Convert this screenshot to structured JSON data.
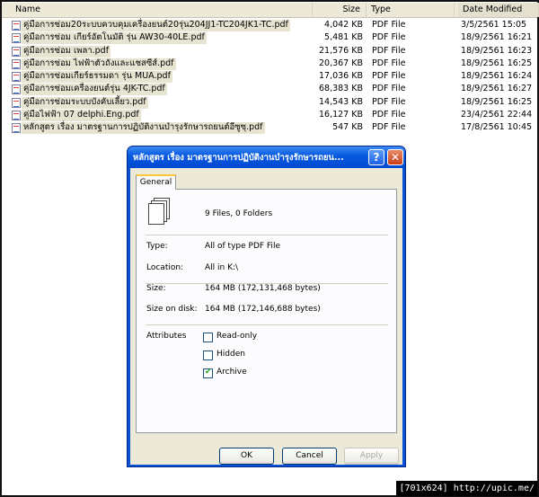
{
  "columns": {
    "name": "Name",
    "size": "Size",
    "type": "Type",
    "date": "Date Modified"
  },
  "files": [
    {
      "name": "คู่มือการซ่อม20ระบบควบคุมเครื่องยนต์20รุ่น204JJ1-TC204JK1-TC.pdf",
      "size": "4,042 KB",
      "type": "PDF File",
      "date": "3/5/2561 15:05"
    },
    {
      "name": "คู่มือการซ่อม เกียร์อัตโนมัติ รุ่น AW30-40LE.pdf",
      "size": "5,481 KB",
      "type": "PDF File",
      "date": "18/9/2561 16:21"
    },
    {
      "name": "คู่มือการซ่อม เพลา.pdf",
      "size": "21,576 KB",
      "type": "PDF File",
      "date": "18/9/2561 16:23"
    },
    {
      "name": "คู่มือการซ่อม ไฟฟ้าตัวถังและแชสซีส์.pdf",
      "size": "20,367 KB",
      "type": "PDF File",
      "date": "18/9/2561 16:25"
    },
    {
      "name": "คู่มือการซ่อมเกียร์ธรรมดา รุ่น MUA.pdf",
      "size": "17,036 KB",
      "type": "PDF File",
      "date": "18/9/2561 16:24"
    },
    {
      "name": "คู่มือการซ่อมเครื่องยนต์รุ่น 4JK-TC.pdf",
      "size": "68,383 KB",
      "type": "PDF File",
      "date": "18/9/2561 16:27"
    },
    {
      "name": "คู่มือการซ่อมระบบบังคับเลี้ยว.pdf",
      "size": "14,543 KB",
      "type": "PDF File",
      "date": "18/9/2561 16:25"
    },
    {
      "name": "คู่มือไฟฟ้า 07 delphi.Eng.pdf",
      "size": "16,127 KB",
      "type": "PDF File",
      "date": "23/4/2561 22:44"
    },
    {
      "name": "หลักสูตร เรื่อง มาตรฐานการปฏิบัติงานบำรุงรักษารถยนต์อีซูซุ.pdf",
      "size": "547 KB",
      "type": "PDF File",
      "date": "17/8/2561 10:45"
    }
  ],
  "dialog": {
    "title": "หลักสูตร เรื่อง มาตรฐานการปฏิบัติงานบำรุงรักษารถยน...",
    "help_label": "?",
    "close_label": "✕",
    "tab_general": "General",
    "summary": "9 Files, 0 Folders",
    "type_label": "Type:",
    "type_value": "All of type PDF File",
    "location_label": "Location:",
    "location_value": "All in K:\\",
    "size_label": "Size:",
    "size_value": "164 MB (172,131,468 bytes)",
    "size_on_disk_label": "Size on disk:",
    "size_on_disk_value": "164 MB (172,146,688 bytes)",
    "attributes_label": "Attributes",
    "readonly_label": "Read-only",
    "hidden_label": "Hidden",
    "archive_label": "Archive",
    "readonly_checked": false,
    "hidden_checked": false,
    "archive_checked": true,
    "ok_label": "OK",
    "cancel_label": "Cancel",
    "apply_label": "Apply"
  },
  "watermark": "[701x624] http://upic.me/"
}
